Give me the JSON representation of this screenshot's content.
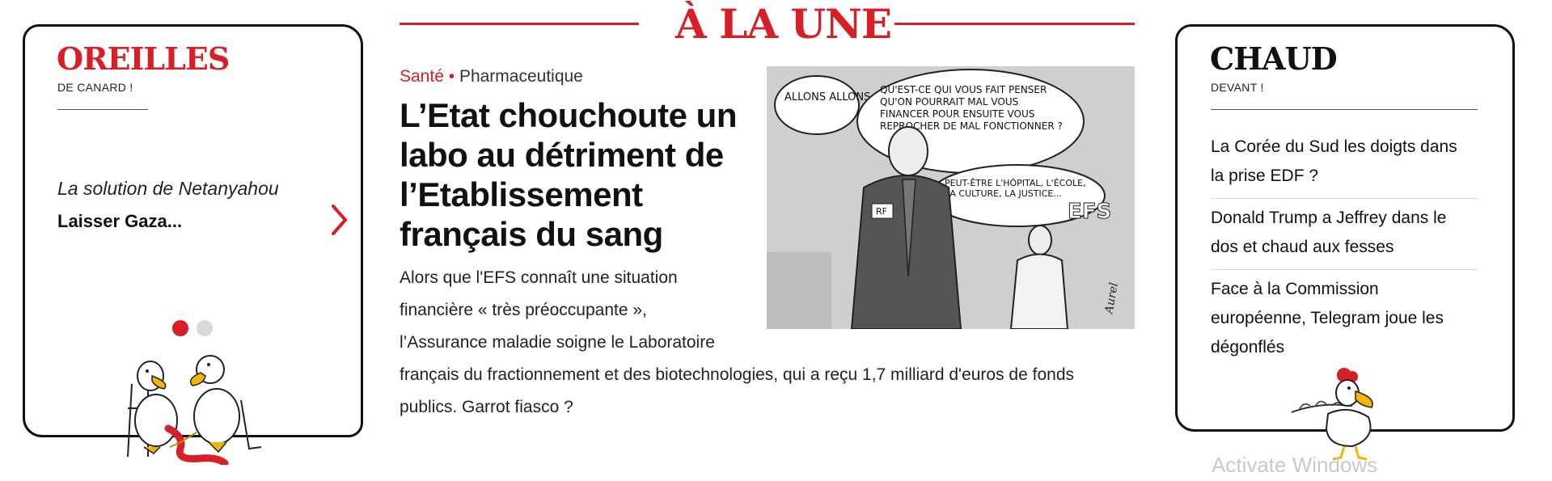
{
  "left_panel": {
    "title": "OREILLES",
    "subtitle": "DE CANARD !",
    "quote_intro": "La solution de Netanyahou",
    "quote_text": "Laisser Gaza...",
    "next_label": "›",
    "dots": [
      "active",
      "inactive"
    ],
    "illustration": "two-ducks-knitting-illustration"
  },
  "center": {
    "section_title": "À LA UNE",
    "kicker_category": "Santé",
    "kicker_separator": "•",
    "kicker_subcategory": "Pharmaceutique",
    "headline": "L’Etat chouchoute un labo au détriment de l’Etablissement français du sang",
    "lede": "Alors que l'EFS connaît une situation financière « très préoccupante », l’Assurance maladie soigne le Laboratoire français du fractionnement et des biotechnologies, qui a reçu 1,7 milliard d'euros de fonds publics. Garrot fiasco ?",
    "cartoon": {
      "bubble_1": "ALLONS ALLONS",
      "bubble_2": "QU'EST-CE QUI VOUS FAIT PENSER QU'ON POURRAIT MAL VOUS FINANCER POUR ENSUITE VOUS REPROCHER DE MAL FONCTIONNER ?",
      "bubble_3": "PEUT-ÊTRE L'HÔPITAL, L'ÉCOLE, LA CULTURE, LA JUSTICE...",
      "badge": "RF",
      "efs": "EFS",
      "signature": "Aurel"
    }
  },
  "right_panel": {
    "title": "CHAUD",
    "subtitle": "DEVANT !",
    "items": [
      "La Corée du Sud les doigts dans la prise EDF ?",
      "Donald Trump a Jeffrey dans le dos et chaud aux fesses",
      "Face à la Commission européenne, Telegram joue les dégonflés"
    ],
    "illustration": "rooster-with-branch-illustration"
  },
  "watermark": "Activate Windows",
  "colors": {
    "accent": "#d61f26",
    "text": "#111111"
  }
}
